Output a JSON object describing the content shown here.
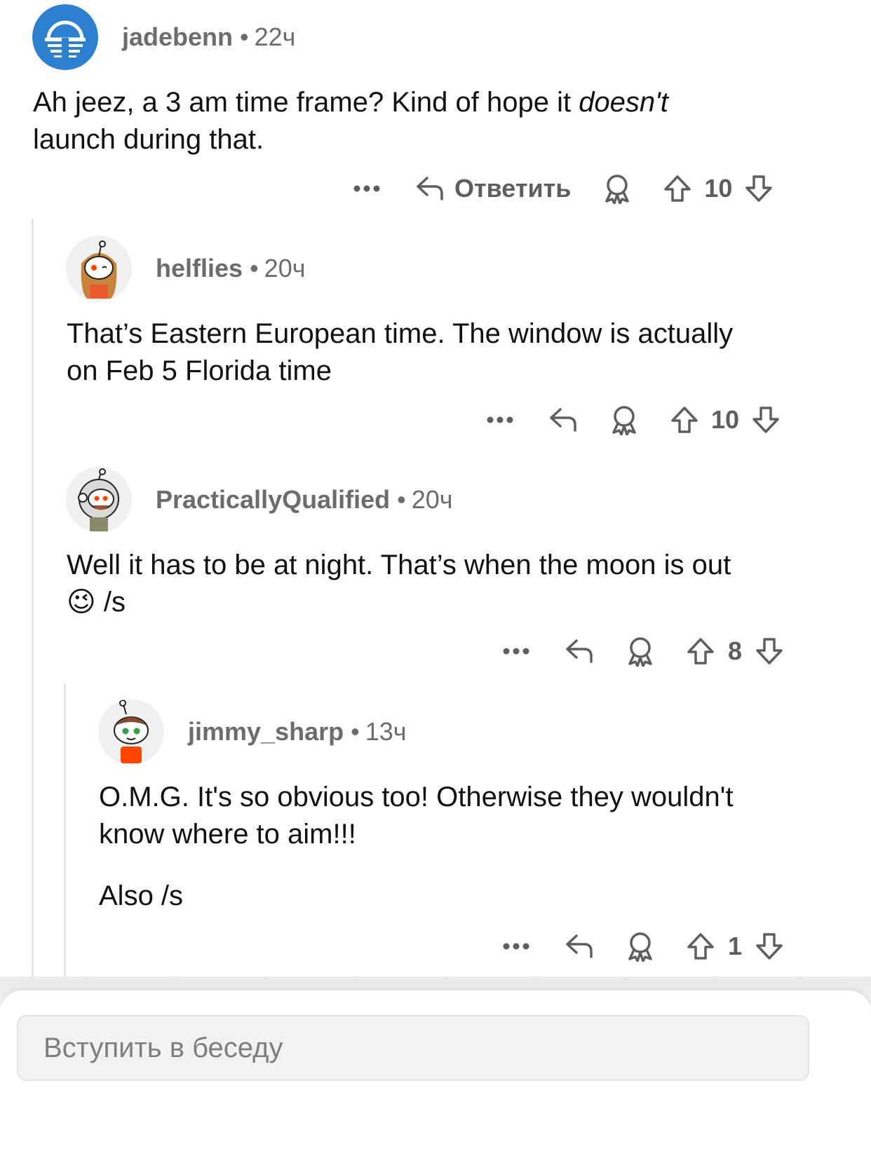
{
  "comments": [
    {
      "username": "jadebenn",
      "time": "22ч",
      "body_parts": [
        "Ah jeez, a 3 am time frame? Kind of hope it ",
        "doesn't",
        "launch during that."
      ],
      "reply_label": "Ответить",
      "score": "10",
      "avatar": "sunset-logo-avatar"
    },
    {
      "username": "helflies",
      "time": "20ч",
      "body_lines": [
        "That’s Eastern European time.  The window is actually",
        "on Feb 5 Florida time"
      ],
      "score": "10",
      "avatar": "snoo-long-hair-avatar"
    },
    {
      "username": "PracticallyQualified",
      "time": "20ч",
      "body_lines": [
        "Well it has to be at night. That’s when the moon is out",
        "/s"
      ],
      "emoji": "😉",
      "score": "8",
      "avatar": "snoo-astronaut-avatar"
    },
    {
      "username": "jimmy_sharp",
      "time": "13ч",
      "body_lines": [
        "O.M.G. It's so obvious too! Otherwise they wouldn't",
        "know where to aim!!!",
        "Also /s"
      ],
      "score": "1",
      "avatar": "snoo-green-eyes-avatar"
    }
  ],
  "separator": "•",
  "composer": {
    "placeholder": "Вступить в беседу"
  },
  "colors": {
    "avatar_blue": "#2d7fd0",
    "meta_gray": "#6a6c6e",
    "snoo_orange": "#ff4500"
  }
}
